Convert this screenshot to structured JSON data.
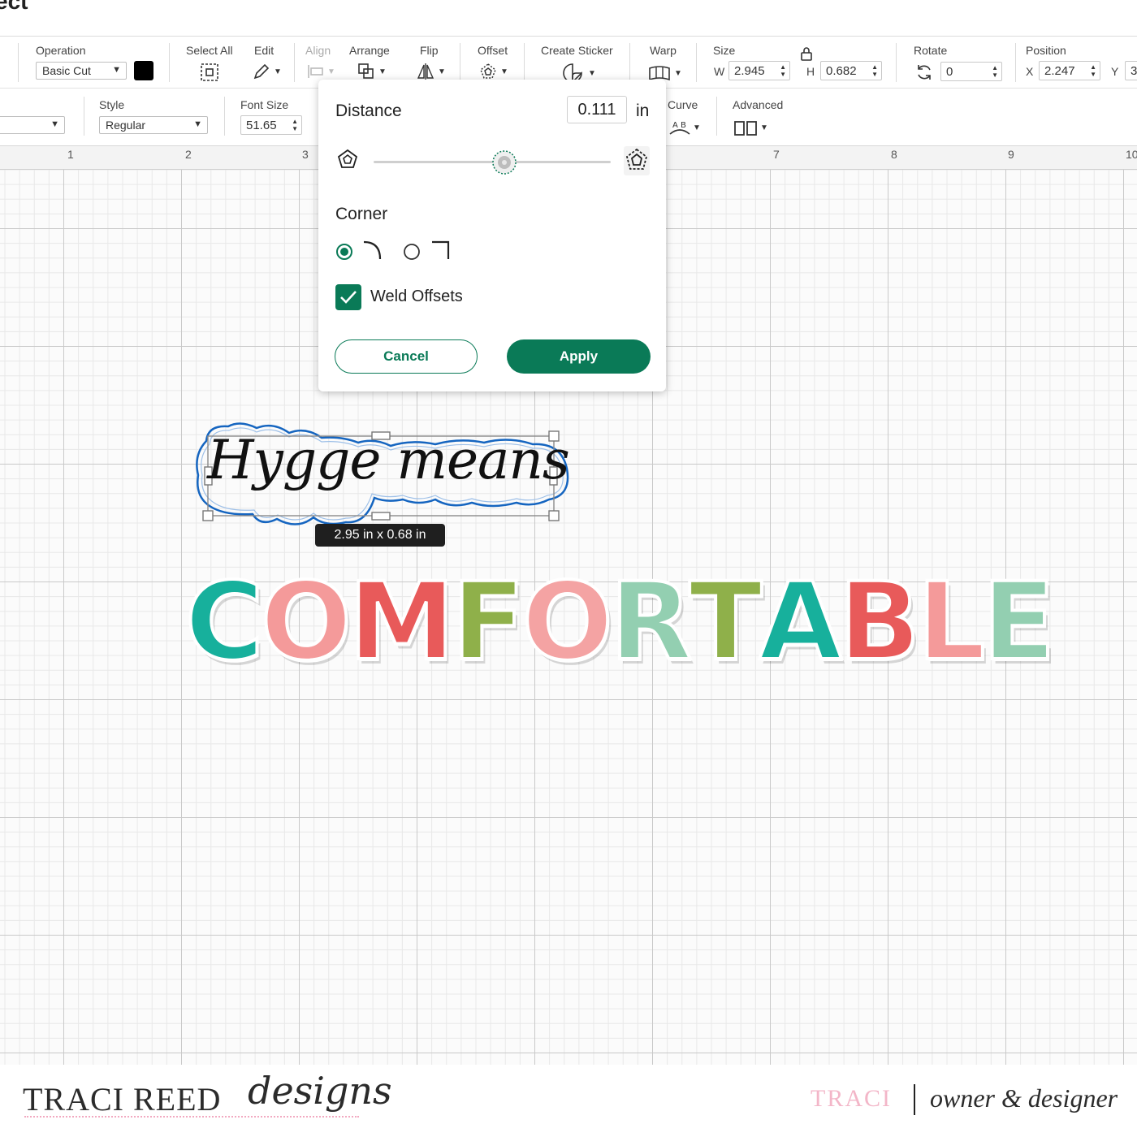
{
  "window": {
    "title": "ect\""
  },
  "toolbar": {
    "operation": {
      "label": "Operation",
      "value": "Basic Cut",
      "color": "#000000"
    },
    "select_all": {
      "label": "Select All"
    },
    "edit": {
      "label": "Edit"
    },
    "align": {
      "label": "Align"
    },
    "arrange": {
      "label": "Arrange"
    },
    "flip": {
      "label": "Flip"
    },
    "offset": {
      "label": "Offset"
    },
    "create_sticker": {
      "label": "Create Sticker"
    },
    "warp": {
      "label": "Warp"
    },
    "size": {
      "label": "Size",
      "w_label": "W",
      "w_value": "2.945",
      "h_label": "H",
      "h_value": "0.682"
    },
    "rotate": {
      "label": "Rotate",
      "value": "0"
    },
    "position": {
      "label": "Position",
      "x_label": "X",
      "x_value": "2.247",
      "y_label": "Y",
      "y_value": "3"
    }
  },
  "text_toolbar": {
    "style": {
      "label": "Style",
      "value": "Regular"
    },
    "font_size": {
      "label": "Font Size",
      "value": "51.65"
    },
    "curve": {
      "label": "Curve"
    },
    "advanced": {
      "label": "Advanced"
    }
  },
  "ruler": {
    "ticks": [
      "1",
      "2",
      "3",
      "7",
      "8",
      "9",
      "10"
    ]
  },
  "offset_popup": {
    "distance_label": "Distance",
    "distance_value": "0.111",
    "distance_unit": "in",
    "slider_level": 0.55,
    "corner_label": "Corner",
    "corner_selected": "rounded",
    "weld_label": "Weld Offsets",
    "weld_checked": true,
    "cancel_label": "Cancel",
    "apply_label": "Apply"
  },
  "design": {
    "script_text": "Hygge means",
    "dimension_tooltip": "2.95  in x 0.68  in",
    "block_text": "COMFORTABLE",
    "block_letter_colors": [
      "#17b09c",
      "#f49a9a",
      "#e85a5a",
      "#8fb04a",
      "#f4a3a3",
      "#93cfb1",
      "#8fb04a",
      "#17b09c",
      "#e85a5a",
      "#f49a9a",
      "#93cfb1"
    ],
    "selection_outline_color": "#1565c0"
  },
  "footer": {
    "brand_left": "TRACI REED",
    "brand_script": "designs",
    "brand_right": "TRACI",
    "role": "owner & designer"
  },
  "colors": {
    "accent": "#0a7a57",
    "accent_pink": "#f3b6c8"
  }
}
